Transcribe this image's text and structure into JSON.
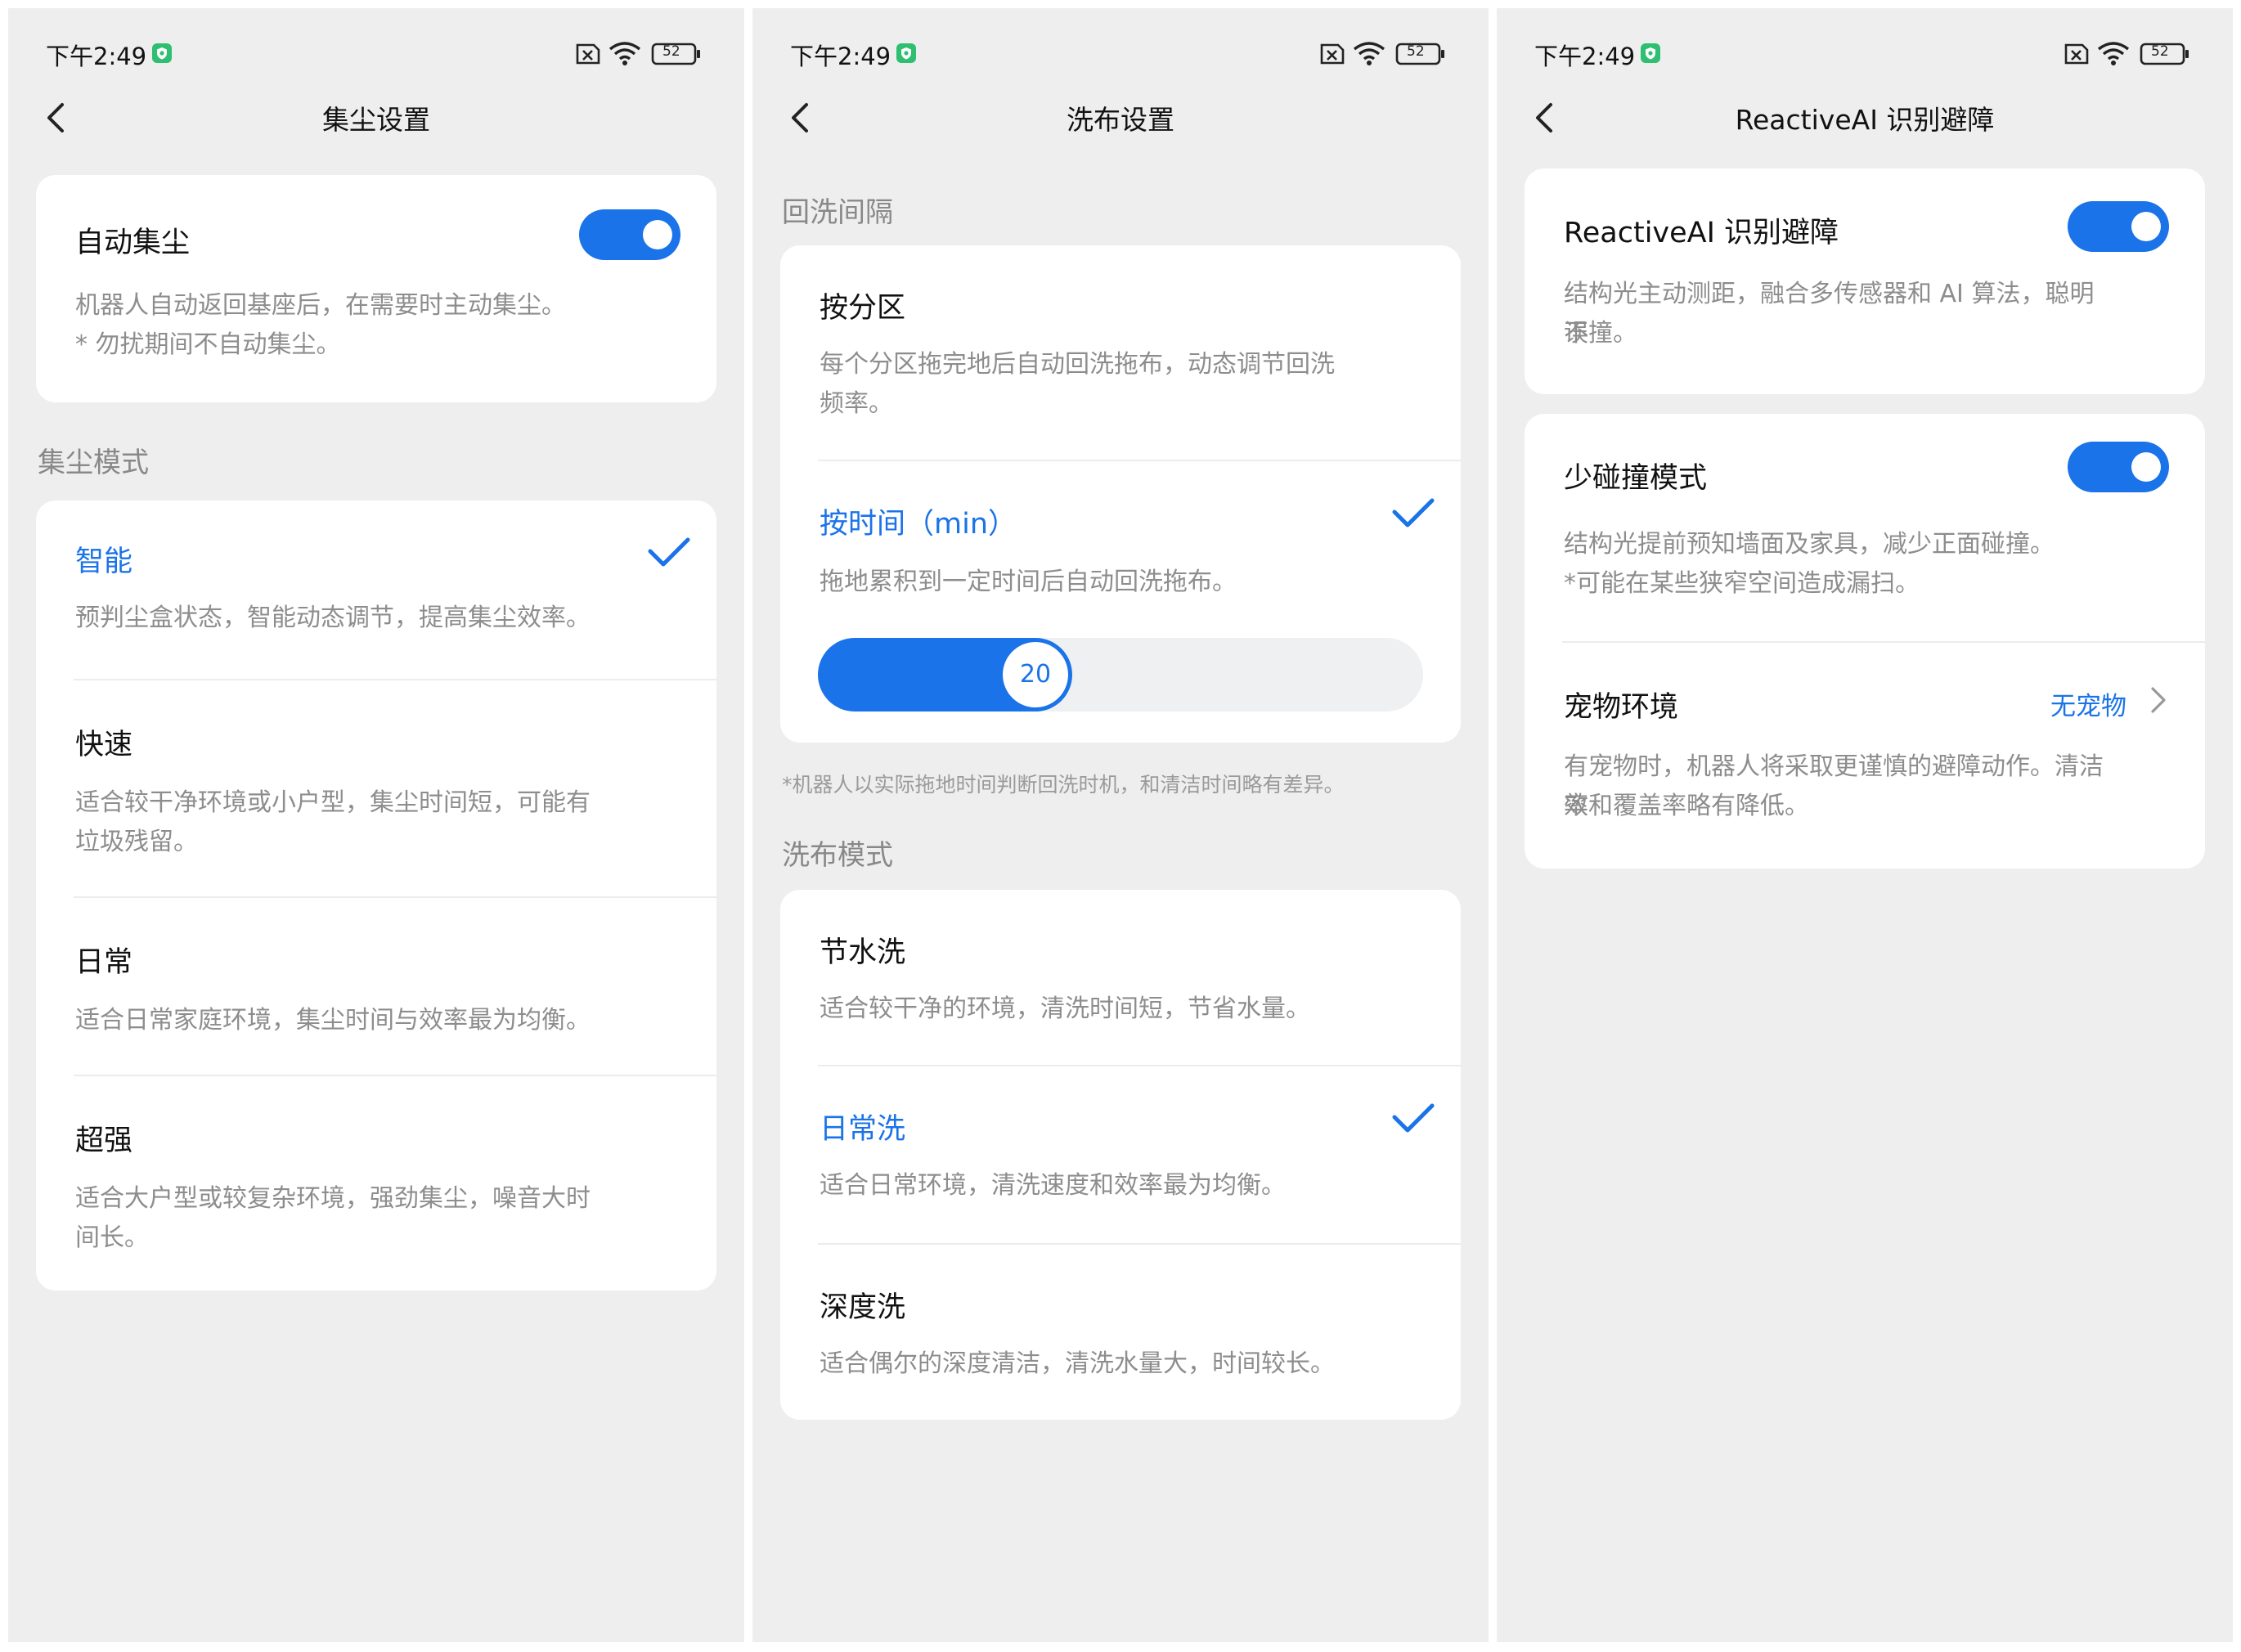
{
  "status": {
    "time": "下午2:49",
    "battery": "52"
  },
  "panel1": {
    "title": "集尘设置",
    "auto": {
      "label": "自动集尘",
      "enabled": true,
      "desc1": "机器人自动返回基座后，在需要时主动集尘。",
      "desc2": "* 勿扰期间不自动集尘。"
    },
    "mode_header": "集尘模式",
    "modes": [
      {
        "label": "智能",
        "selected": true,
        "desc1": "预判尘盒状态，智能动态调节，提高集尘效率。",
        "desc2": ""
      },
      {
        "label": "快速",
        "selected": false,
        "desc1": "适合较干净环境或小户型，集尘时间短，可能有",
        "desc2": "垃圾残留。"
      },
      {
        "label": "日常",
        "selected": false,
        "desc1": "适合日常家庭环境，集尘时间与效率最为均衡。",
        "desc2": ""
      },
      {
        "label": "超强",
        "selected": false,
        "desc1": "适合大户型或较复杂环境，强劲集尘，噪音大时",
        "desc2": "间长。"
      }
    ]
  },
  "panel2": {
    "title": "洗布设置",
    "interval_header": "回洗间隔",
    "intervals": [
      {
        "label": "按分区",
        "selected": false,
        "desc1": "每个分区拖完地后自动回洗拖布，动态调节回洗",
        "desc2": "频率。"
      },
      {
        "label": "按时间（min）",
        "selected": true,
        "desc1": "拖地累积到一定时间后自动回洗拖布。",
        "desc2": ""
      }
    ],
    "slider": {
      "value": "20",
      "fraction": 0.34
    },
    "note": "*机器人以实际拖地时间判断回洗时机，和清洁时间略有差异。",
    "mode_header": "洗布模式",
    "modes": [
      {
        "label": "节水洗",
        "selected": false,
        "desc1": "适合较干净的环境，清洗时间短，节省水量。"
      },
      {
        "label": "日常洗",
        "selected": true,
        "desc1": "适合日常环境，清洗速度和效率最为均衡。"
      },
      {
        "label": "深度洗",
        "selected": false,
        "desc1": "适合偶尔的深度清洁，清洗水量大，时间较长。"
      }
    ]
  },
  "panel3": {
    "title": "ReactiveAI 识别避障",
    "ai": {
      "label": "ReactiveAI 识别避障",
      "enabled": true,
      "desc1": "结构光主动测距，融合多传感器和 AI 算法，聪明不",
      "desc2": "误撞。"
    },
    "less_collision": {
      "label": "少碰撞模式",
      "enabled": true,
      "desc1": "结构光提前预知墙面及家具，减少正面碰撞。",
      "desc2": "*可能在某些狭窄空间造成漏扫。"
    },
    "pet": {
      "label": "宠物环境",
      "value": "无宠物",
      "desc1": "有宠物时，机器人将采取更谨慎的避障动作。清洁效",
      "desc2": "率和覆盖率略有降低。"
    }
  },
  "icons": [
    "back-icon",
    "check-icon",
    "chevron-right-icon",
    "wifi-icon",
    "battery-icon",
    "sim-off-icon",
    "shield-icon"
  ],
  "colors": {
    "accent": "#1a73e8",
    "panel_bg": "#eeeeee",
    "card_bg": "#ffffff",
    "desc": "#8d8d8d"
  }
}
